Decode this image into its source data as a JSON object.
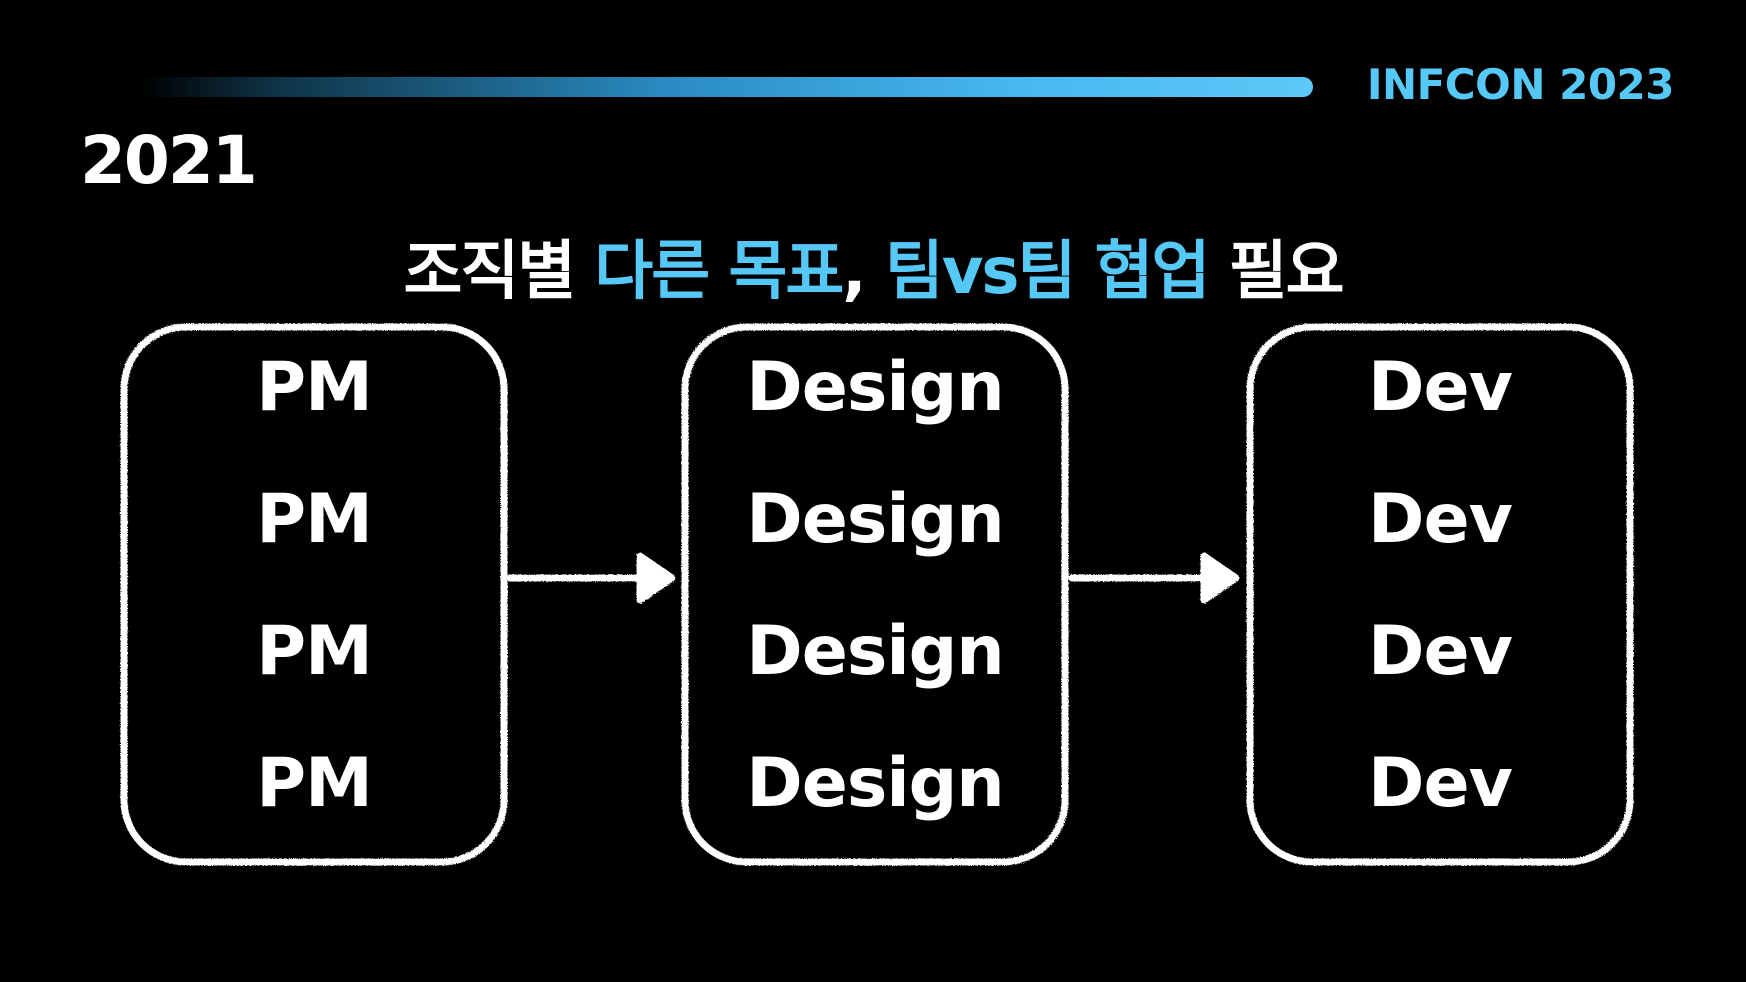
{
  "brand": "INFCON 2023",
  "year": "2021",
  "headline": {
    "part1": "조직별 ",
    "part2": "다른 목표",
    "part3": ", ",
    "part4": "팀vs팀 협업",
    "part5": " 필요"
  },
  "columns": [
    {
      "items": [
        "PM",
        "PM",
        "PM",
        "PM"
      ]
    },
    {
      "items": [
        "Design",
        "Design",
        "Design",
        "Design"
      ]
    },
    {
      "items": [
        "Dev",
        "Dev",
        "Dev",
        "Dev"
      ]
    }
  ],
  "colors": {
    "accent": "#55c8f5",
    "text": "#ffffff",
    "background": "#000000"
  }
}
